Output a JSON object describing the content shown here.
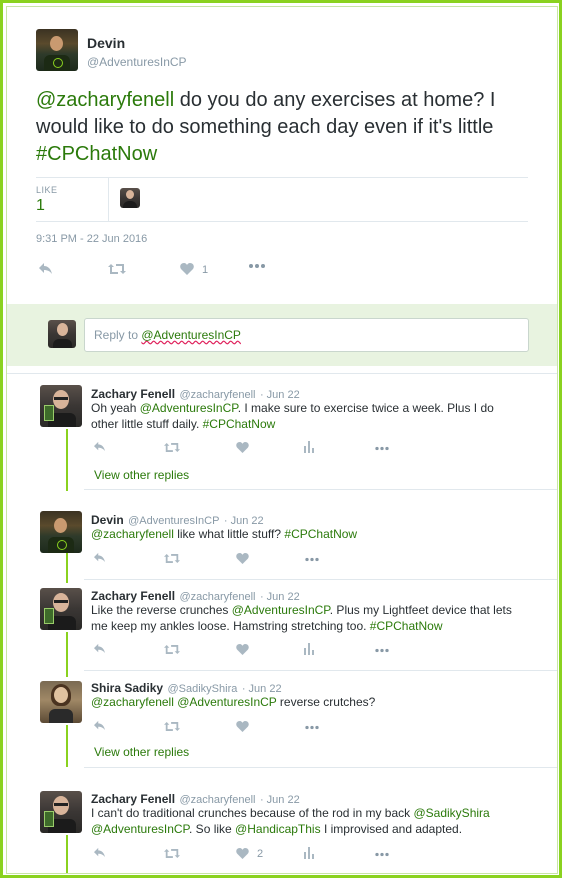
{
  "main_tweet": {
    "name": "Devin",
    "handle": "@AdventuresInCP",
    "text_mention": "@zacharyfenell",
    "text_body": " do you do any exercises at home? I would like to do something each day even if it's little ",
    "text_hashtag": "#CPChatNow",
    "likes_label": "LIKE",
    "likes_count": "1",
    "timestamp": "9:31 PM - 22 Jun 2016",
    "action_like_count": "1"
  },
  "reply_box": {
    "placeholder_prefix": "Reply to ",
    "placeholder_handle": "@AdventuresInCP"
  },
  "replies": [
    {
      "name": "Zachary Fenell",
      "handle": "@zacharyfenell",
      "date": "· Jun 22",
      "line1_pre": "Oh yeah ",
      "line1_mention": "@AdventuresInCP",
      "line1_post": ". I make sure to exercise twice a week. Plus I do",
      "line2_pre": "other little stuff daily. ",
      "line2_hashtag": "#CPChatNow",
      "view_other": "View other replies"
    },
    {
      "name": "Devin",
      "handle": "@AdventuresInCP",
      "date": "· Jun 22",
      "line1_mention": "@zacharyfenell",
      "line1_post": " like what little stuff? ",
      "line1_hashtag": "#CPChatNow"
    },
    {
      "name": "Zachary Fenell",
      "handle": "@zacharyfenell",
      "date": "· Jun 22",
      "line1_pre": "Like the reverse crunches ",
      "line1_mention": "@AdventuresInCP",
      "line1_post": ". Plus my Lightfeet device that lets",
      "line2_pre": "me keep my ankles loose. Hamstring stretching too. ",
      "line2_hashtag": "#CPChatNow"
    },
    {
      "name": "Shira Sadiky",
      "handle": "@SadikyShira",
      "date": "· Jun 22",
      "line1_mention": "@zacharyfenell",
      "line1_mention2": "@AdventuresInCP",
      "line1_post": " reverse crutches?",
      "view_other": "View other replies"
    },
    {
      "name": "Zachary Fenell",
      "handle": "@zacharyfenell",
      "date": "· Jun 22",
      "line1_pre": "I can't do traditional crunches because of the rod in my back ",
      "line1_mention": "@SadikyShira",
      "line2_mention": "@AdventuresInCP",
      "line2_mid": ". So like ",
      "line2_mention2": "@HandicapThis",
      "line2_post": " I improvised and adapted.",
      "like_count": "2"
    }
  ],
  "colors": {
    "border": "#8ad21f",
    "link": "#2b7a0b",
    "icon": "#aab8c2"
  }
}
